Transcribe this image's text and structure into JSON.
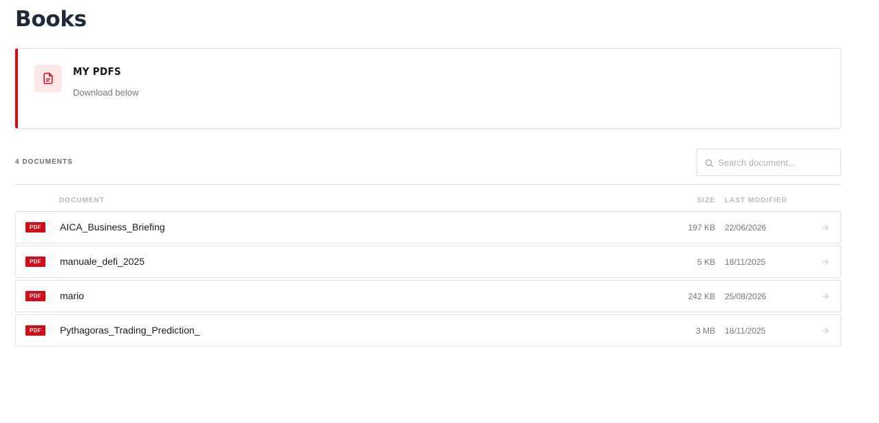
{
  "page": {
    "title": "Books"
  },
  "banner": {
    "icon": "document-icon",
    "title": "MY PDFS",
    "subtitle": "Download below",
    "accent_color": "#d90a14"
  },
  "toolbar": {
    "count_label": "4 DOCUMENTS",
    "search": {
      "placeholder": "Search document...",
      "value": "",
      "icon": "search-icon"
    }
  },
  "table": {
    "headers": {
      "document": "DOCUMENT",
      "size": "SIZE",
      "last_modified": "LAST MODIFIED"
    },
    "rows": [
      {
        "badge": "PDF",
        "name": "AICA_Business_Briefing",
        "size": "197 KB",
        "modified": "22/06/2026"
      },
      {
        "badge": "PDF",
        "name": "manuale_defi_2025",
        "size": "5 KB",
        "modified": "18/11/2025"
      },
      {
        "badge": "PDF",
        "name": "mario",
        "size": "242 KB",
        "modified": "25/08/2026"
      },
      {
        "badge": "PDF",
        "name": "Pythagoras_Trading_Prediction_",
        "size": "3 MB",
        "modified": "18/11/2025"
      }
    ]
  }
}
